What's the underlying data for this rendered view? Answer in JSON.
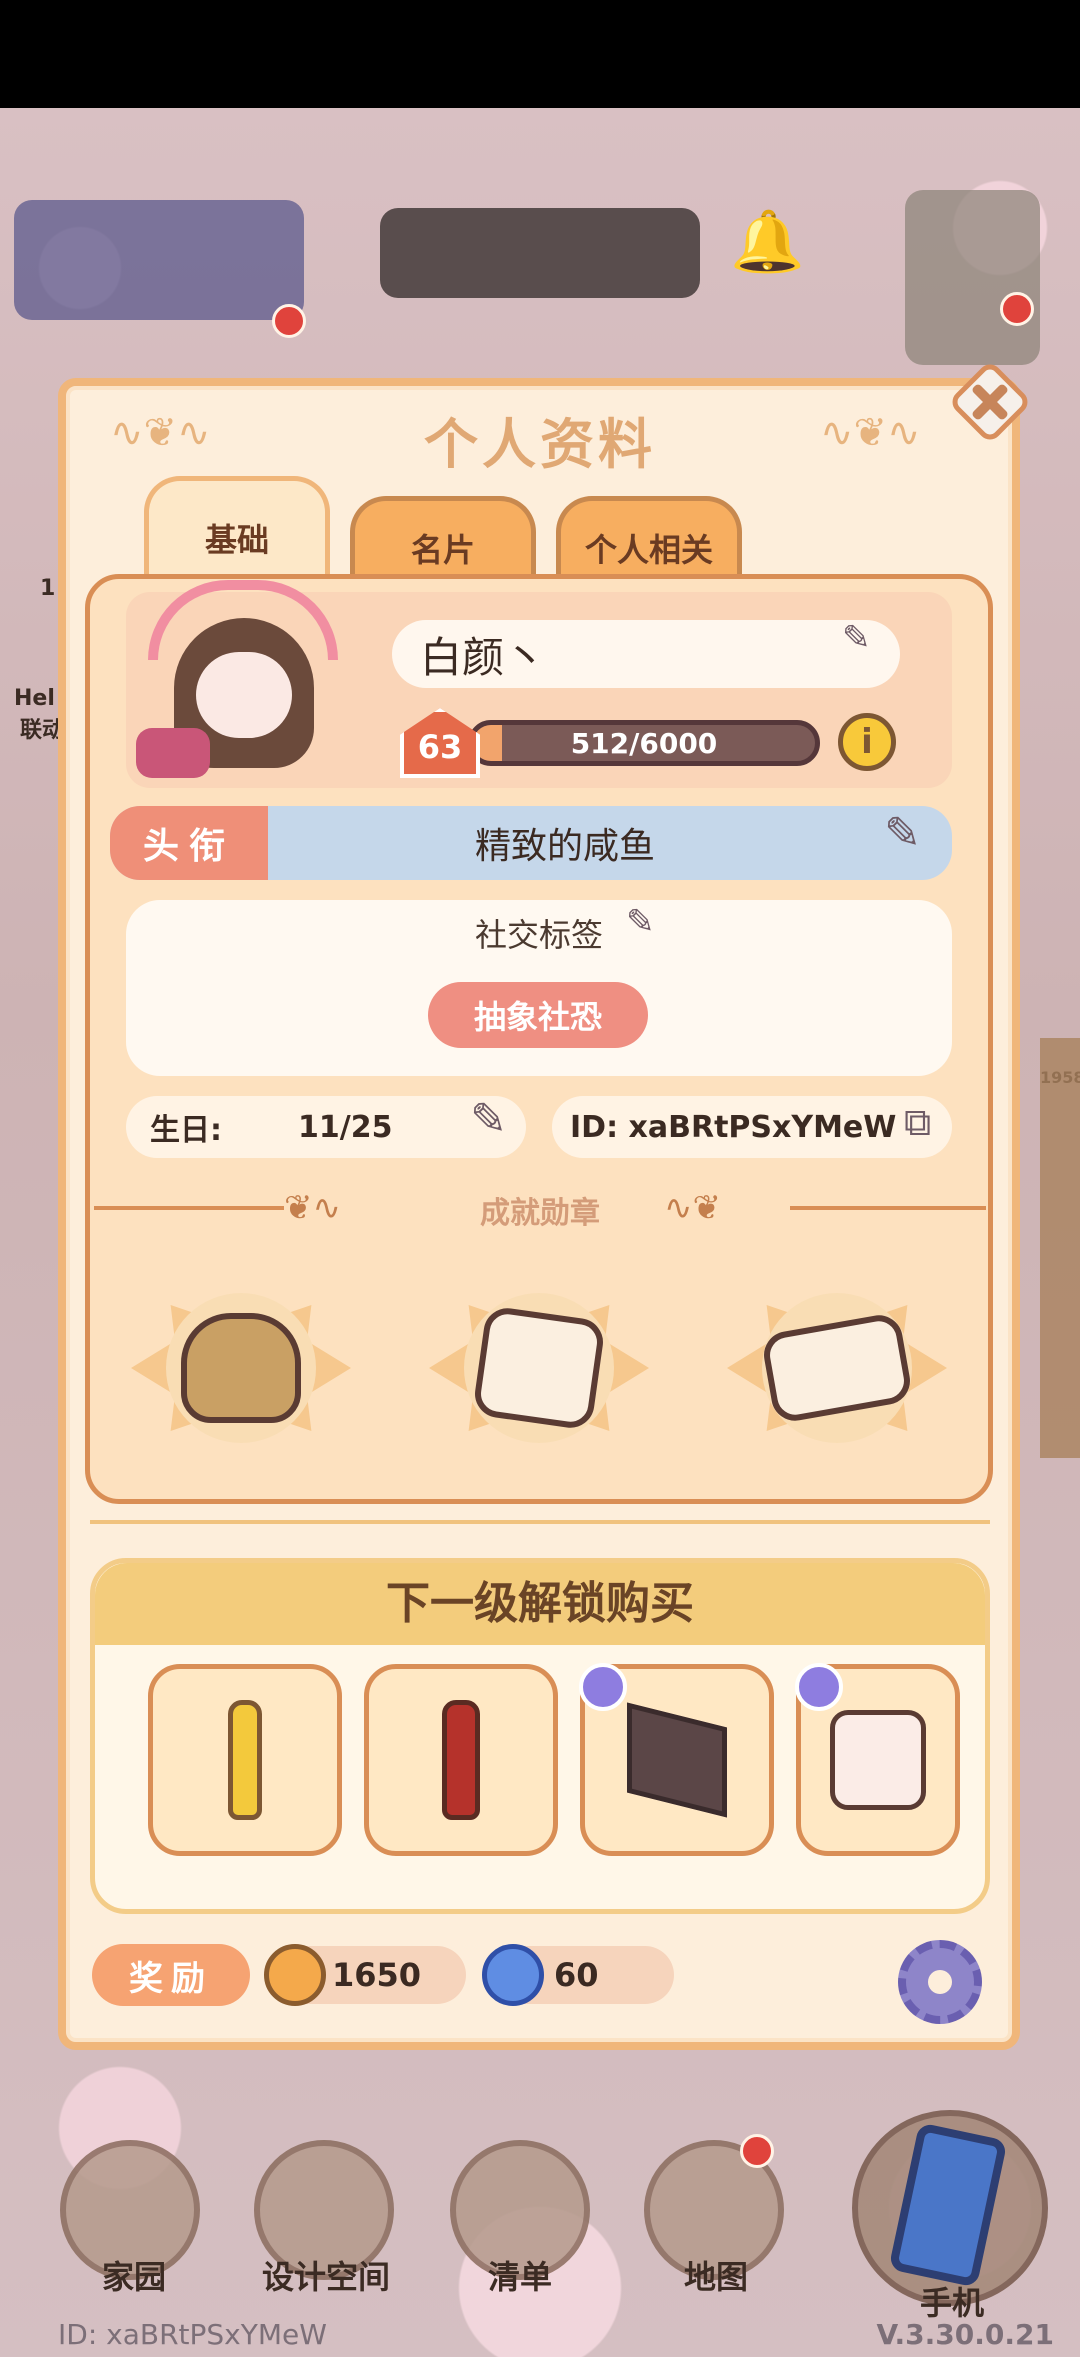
{
  "panel": {
    "title": "个人资料",
    "tabs": [
      {
        "label": "基础",
        "active": true
      },
      {
        "label": "名片",
        "active": false
      },
      {
        "label": "个人相关",
        "active": false
      }
    ]
  },
  "profile": {
    "name": "白颜丶",
    "level": "63",
    "xp_text": "512/6000",
    "xp_fraction": 0.0853,
    "title_label": "头衔",
    "title_value": "精致的咸鱼",
    "social_tag_title": "社交标签",
    "social_tag": "抽象社恐",
    "birthday_label": "生日:",
    "birthday_value": "11/25",
    "id_text": "ID: xaBRtPSxYMeW"
  },
  "medals": {
    "header": "成就勋章",
    "items": [
      "coin-bag-icon",
      "star-scroll-icon",
      "envelope-icon"
    ]
  },
  "unlock": {
    "header": "下一级解锁购买",
    "items": [
      "yellow-bottle-icon",
      "cola-bottle-icon",
      "tv-screen-icon",
      "nightstand-icon"
    ]
  },
  "rewards": {
    "label": "奖励",
    "coins": "1650",
    "gems": "60"
  },
  "background": {
    "side_text_1": "Hel",
    "side_text_2": "联动",
    "side_text_3": "1",
    "side_number": "1958"
  },
  "nav": {
    "home": "家园",
    "design": "设计空间",
    "list": "清单",
    "map": "地图",
    "phone": "手机"
  },
  "footer": {
    "id": "ID: xaBRtPSxYMeW",
    "version": "V.3.30.0.21"
  },
  "colors": {
    "panel_bg": "#fdeedb",
    "panel_border": "#f0b67a",
    "title_color": "#e0a874",
    "accent_red": "#ef8f82",
    "title_row_bg": "#c5d7ea"
  }
}
